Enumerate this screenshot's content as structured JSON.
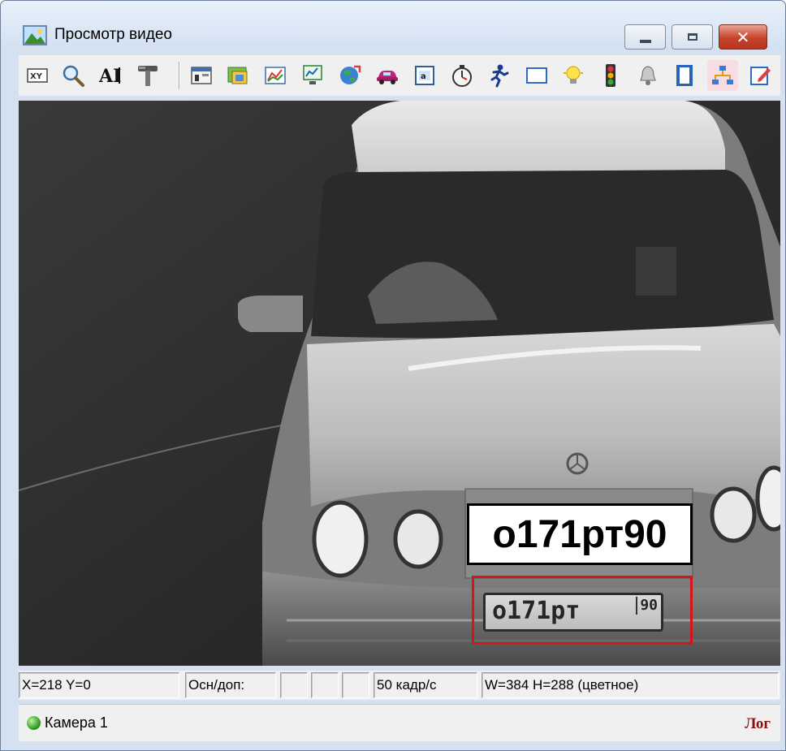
{
  "window": {
    "title": "Просмотр видео",
    "close_glyph": "✕"
  },
  "toolbar": {
    "tools": [
      {
        "name": "xy-coordinates-icon"
      },
      {
        "name": "magnifier-icon"
      },
      {
        "name": "text-ai-icon"
      },
      {
        "name": "hammer-tools-icon"
      },
      {
        "name": "settings-panel-icon"
      },
      {
        "name": "map-layers-icon"
      },
      {
        "name": "chart-graph-icon"
      },
      {
        "name": "monitor-graph-icon"
      },
      {
        "name": "globe-route-icon"
      },
      {
        "name": "car-icon"
      },
      {
        "name": "text-frame-icon"
      },
      {
        "name": "stopwatch-icon"
      },
      {
        "name": "running-person-icon"
      },
      {
        "name": "empty-frame-icon"
      },
      {
        "name": "light-bulb-icon"
      },
      {
        "name": "traffic-light-icon"
      },
      {
        "name": "bell-icon"
      },
      {
        "name": "film-strip-icon"
      },
      {
        "name": "network-icon",
        "active": true
      },
      {
        "name": "edit-note-icon"
      }
    ]
  },
  "video": {
    "recognized_plate": "о171рт90",
    "physical_plate": "о171рт",
    "physical_plate_region": "90"
  },
  "statusbar": {
    "coords": "X=218 Y=0",
    "mode_label": "Осн/доп:",
    "fps": "50 кадр/с",
    "resolution": "W=384 H=288 (цветное)"
  },
  "camerabar": {
    "camera_label": "Камера 1",
    "status_color": "#2f9a1b",
    "log_label": "Лог"
  }
}
